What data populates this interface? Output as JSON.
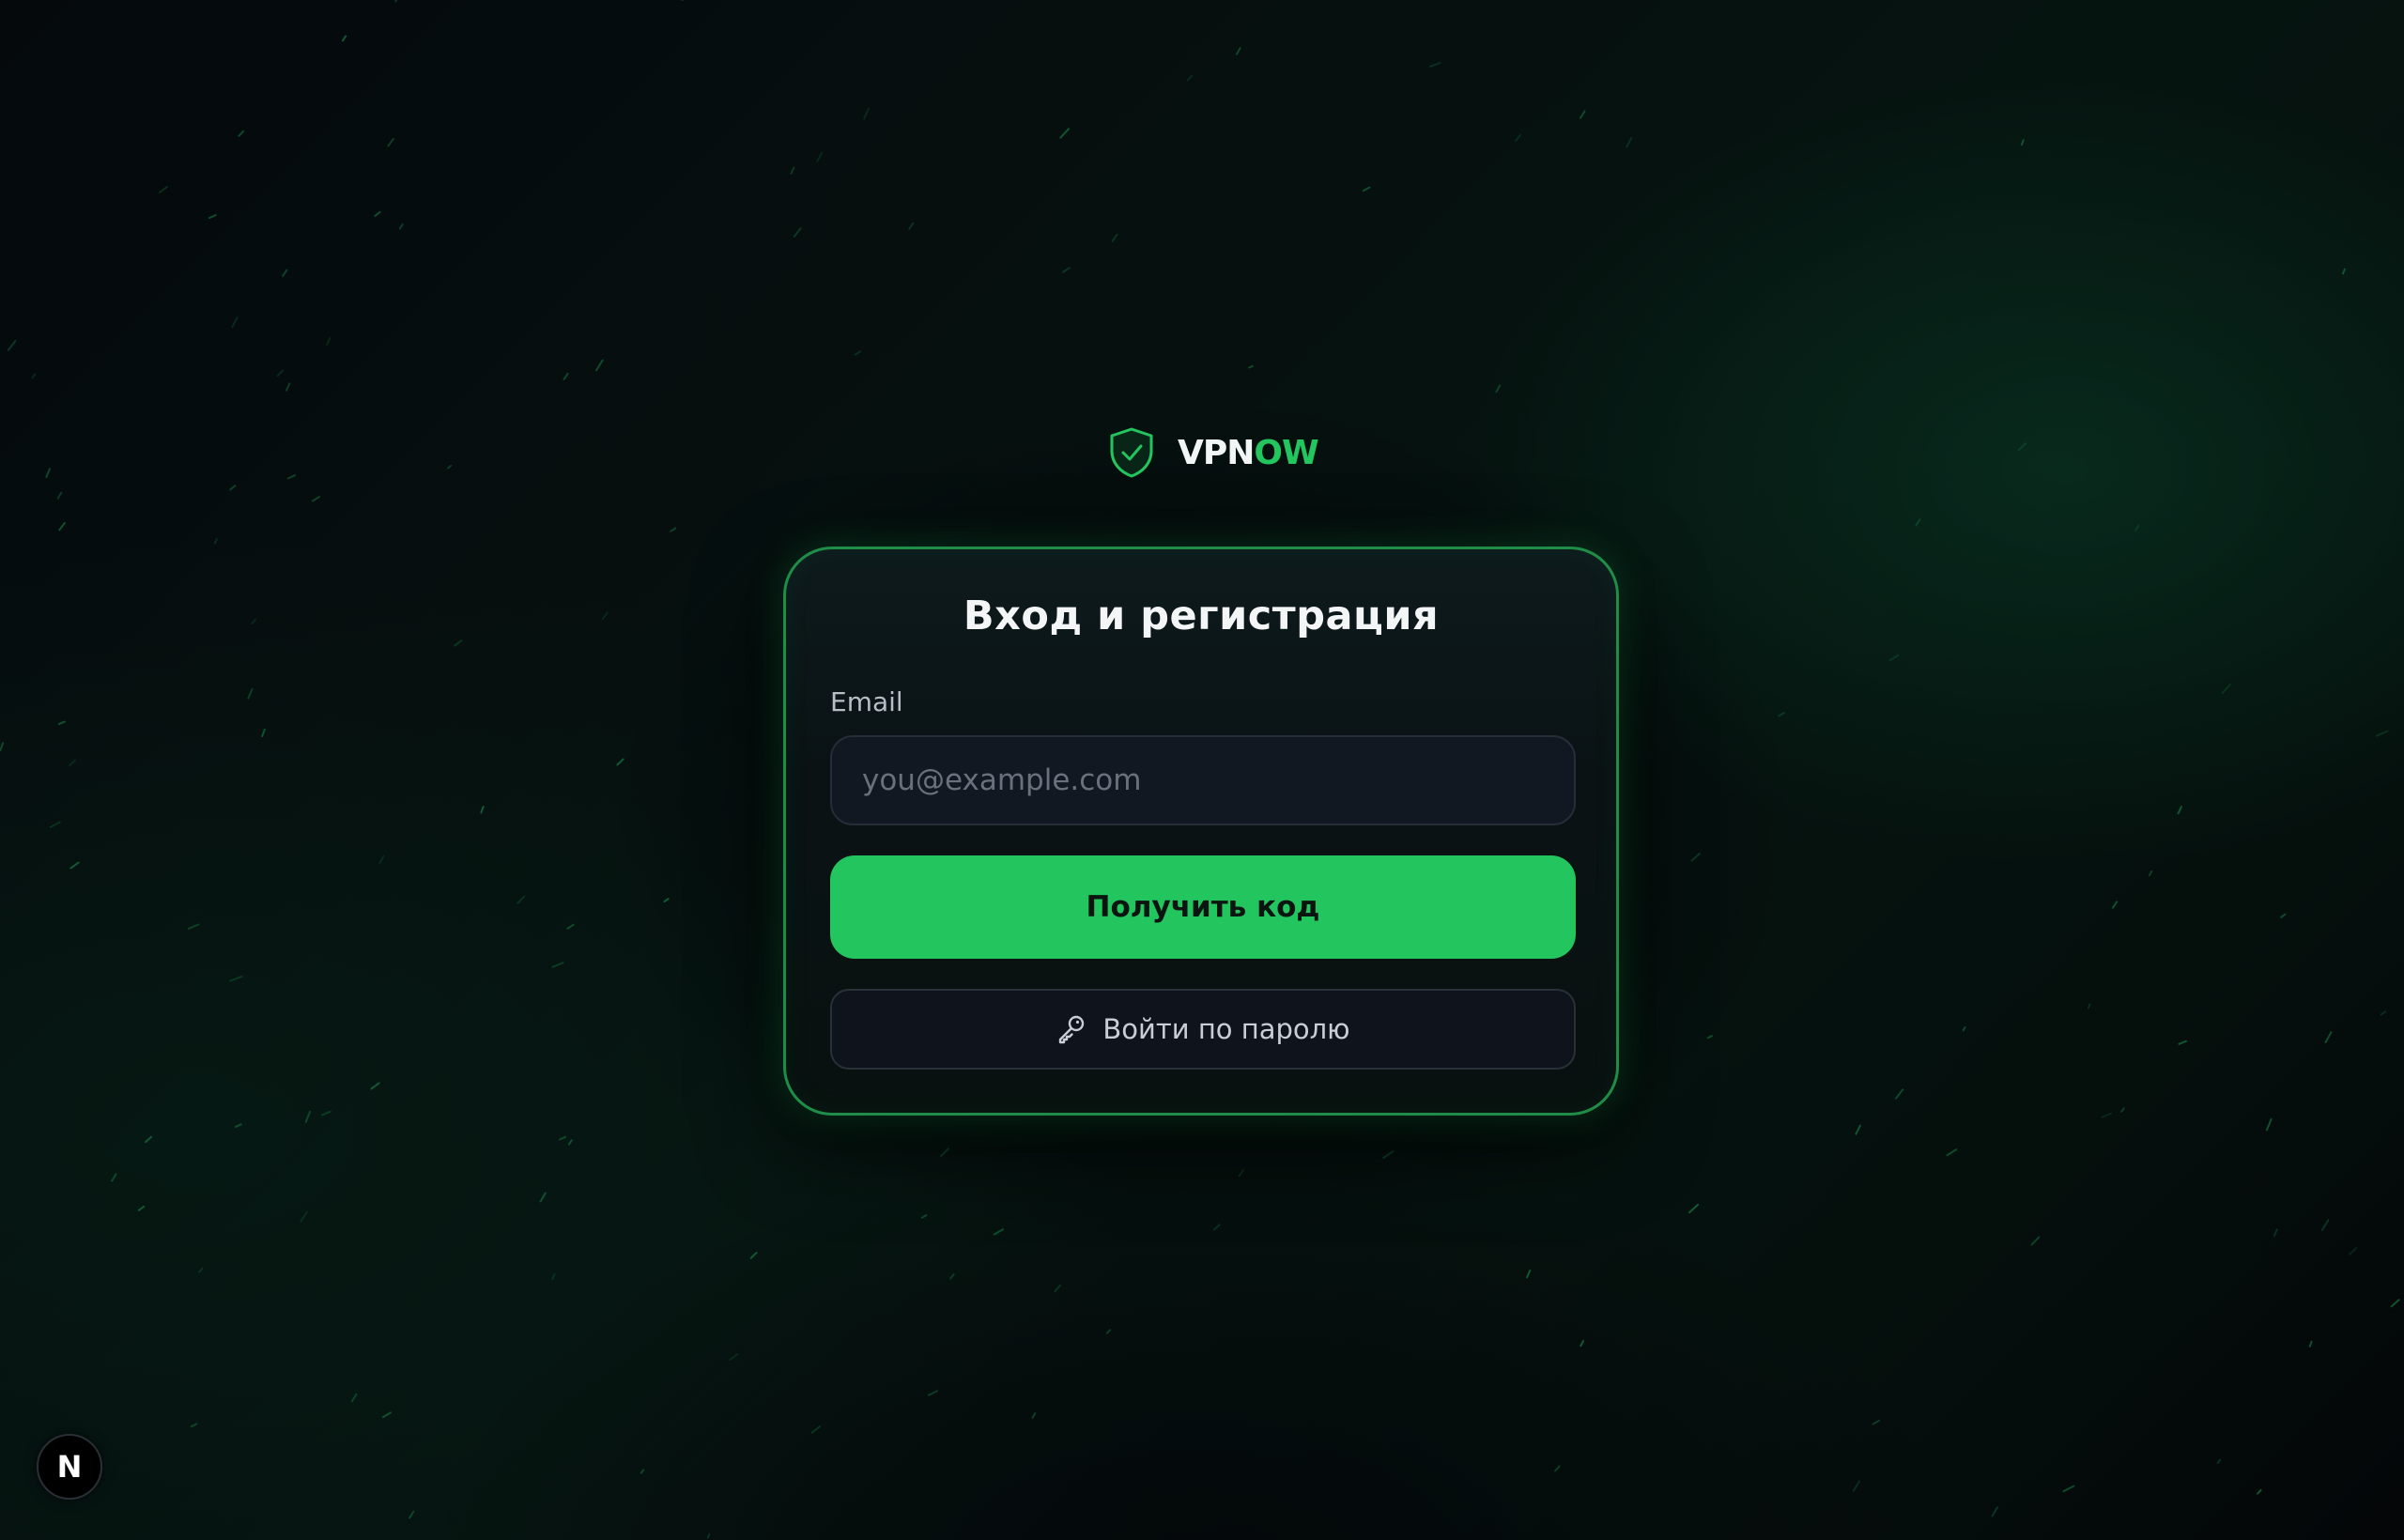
{
  "brand": {
    "name_main": "VPN",
    "name_accent": "OW",
    "logo_icon": "shield-check-icon",
    "accent_color": "#22c55e"
  },
  "auth_card": {
    "title": "Вход и регистрация",
    "email_label": "Email",
    "email_value": "",
    "email_placeholder": "you@example.com",
    "primary_button_label": "Получить код",
    "secondary_button_icon": "key-icon",
    "secondary_button_label": "Войти по паролю"
  },
  "dev_badge": {
    "letter": "N",
    "icon": "nextjs-logo-icon"
  }
}
